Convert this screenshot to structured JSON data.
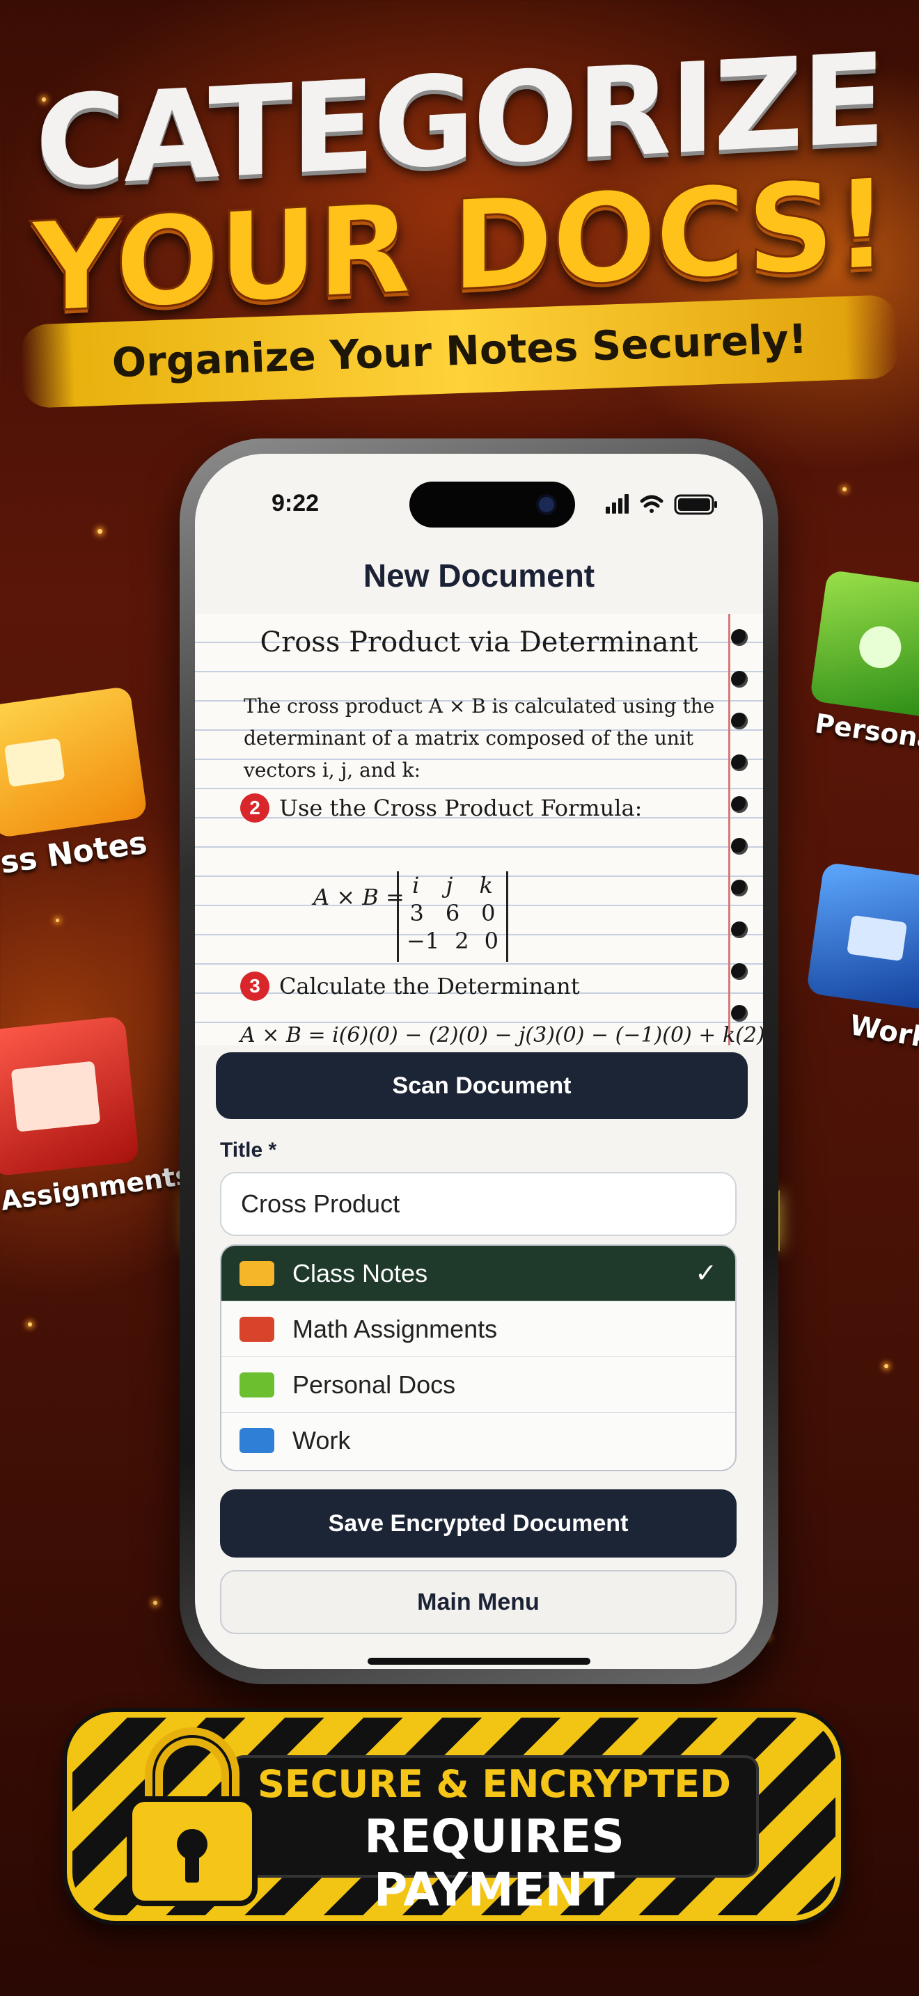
{
  "headline": {
    "line1": "CATEGORIZE",
    "line2": "YOUR DOCS!",
    "subtitle": "Organize Your Notes Securely!"
  },
  "side_folders": [
    {
      "label": "ss Notes",
      "color": "#f5a81a",
      "icon": "notes-folder-icon"
    },
    {
      "label": "Assignments",
      "color": "#d9262b",
      "icon": "assignments-folder-icon"
    },
    {
      "label": "Personal",
      "color": "#3fae2a",
      "icon": "personal-folder-icon"
    },
    {
      "label": "Work",
      "color": "#2466c8",
      "icon": "work-folder-icon"
    }
  ],
  "phone": {
    "status": {
      "time": "9:22",
      "icons": [
        "signal-icon",
        "wifi-icon",
        "battery-icon"
      ]
    },
    "nav_title": "New Document",
    "scanned_page": {
      "title": "Cross Product via Determinant",
      "intro": "The cross product A × B is calculated using the determinant of a matrix composed of the unit vectors i, j, and k:",
      "step2": {
        "number": "2",
        "text": "Use the Cross Product Formula:"
      },
      "matrix_lhs": "A × B =",
      "matrix_rows": [
        [
          "i",
          "j",
          "k"
        ],
        [
          "3",
          "6",
          "0"
        ],
        [
          "−1",
          "2",
          "0"
        ]
      ],
      "step3": {
        "number": "3",
        "text": "Calculate the Determinant"
      },
      "formula": "A × B = i(6)(0) − (2)(0) − j(3)(0) − (−1)(0) + k(2)"
    },
    "scan_button": "Scan Document",
    "title_label": "Title *",
    "title_value": "Cross Product",
    "categories": [
      {
        "label": "Class Notes",
        "color": "#f5b62a",
        "icon": "folder-notes-icon",
        "selected": true
      },
      {
        "label": "Math Assignments",
        "color": "#d8432b",
        "icon": "folder-math-icon",
        "selected": false
      },
      {
        "label": "Personal Docs",
        "color": "#6cbf2e",
        "icon": "folder-personal-icon",
        "selected": false
      },
      {
        "label": "Work",
        "color": "#2f7fd6",
        "icon": "folder-work-icon",
        "selected": false
      }
    ],
    "check_glyph": "✓",
    "save_button": "Save Encrypted Document",
    "menu_button": "Main Menu"
  },
  "badge": {
    "line1": "SECURE & ENCRYPTED",
    "line2": "REQUIRES PAYMENT",
    "icon": "padlock-icon"
  },
  "colors": {
    "accent_yellow": "#ffc21a",
    "dark_button": "#1c2536",
    "selected_row": "#1f3a2a"
  }
}
